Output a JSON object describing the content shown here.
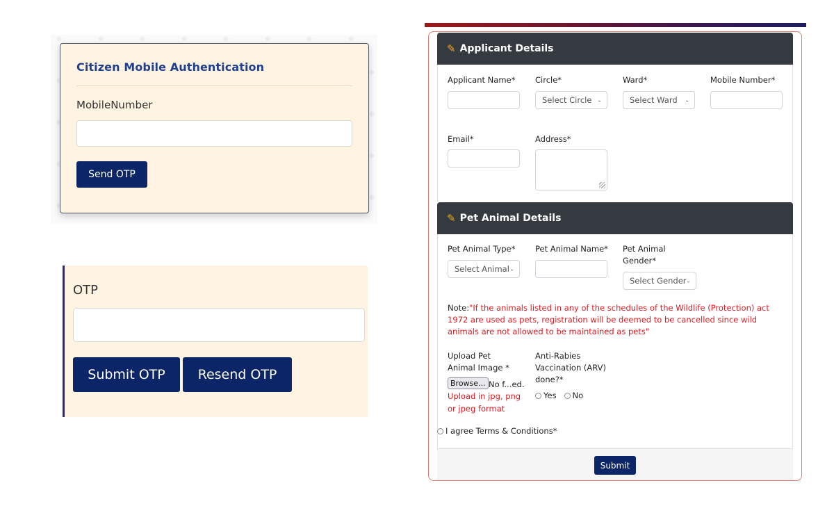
{
  "mobile_auth": {
    "title": "Citizen Mobile Authentication",
    "mobile_label": "MobileNumber",
    "mobile_value": "",
    "send_otp_label": "Send OTP"
  },
  "otp": {
    "label": "OTP",
    "value": "",
    "submit_label": "Submit OTP",
    "resend_label": "Resend OTP"
  },
  "applicant": {
    "section_title": "Applicant Details",
    "section_icon": "edit-icon",
    "fields": {
      "name_label": "Applicant Name*",
      "name_value": "",
      "circle_label": "Circle*",
      "circle_selected": "Select Circle",
      "ward_label": "Ward*",
      "ward_selected": "Select Ward",
      "mobile_label": "Mobile Number*",
      "mobile_value": "",
      "email_label": "Email*",
      "email_value": "",
      "address_label": "Address*",
      "address_value": ""
    }
  },
  "pet": {
    "section_title": "Pet Animal Details",
    "section_icon": "edit-icon",
    "fields": {
      "type_label": "Pet Animal Type*",
      "type_selected": "Select Animal",
      "name_label": "Pet Animal Name*",
      "name_value": "",
      "gender_label_line1": "Pet Animal",
      "gender_label_line2": "Gender*",
      "gender_selected": "Select Gender"
    },
    "note_label": "Note:",
    "note_text": "\"If the animals listed in any of the schedules of the Wildlife (Protection) act 1972 are used as pets, registration will be deemed to be cancelled since wild animals are not allowed to be maintained as pets\"",
    "upload": {
      "label_line1": "Upload Pet",
      "label_line2": "Animal Image *",
      "browse_label": "Browse...",
      "file_status": "No f...ed.",
      "hint_line1": "Upload in jpg, png",
      "hint_line2": "or jpeg format"
    },
    "arv": {
      "label_line1": "Anti-Rabies",
      "label_line2": "Vaccination (ARV)",
      "label_line3": "done?*",
      "options": [
        "Yes",
        "No"
      ]
    }
  },
  "terms_label": "I agree Terms & Conditions*",
  "submit_label": "Submit"
}
